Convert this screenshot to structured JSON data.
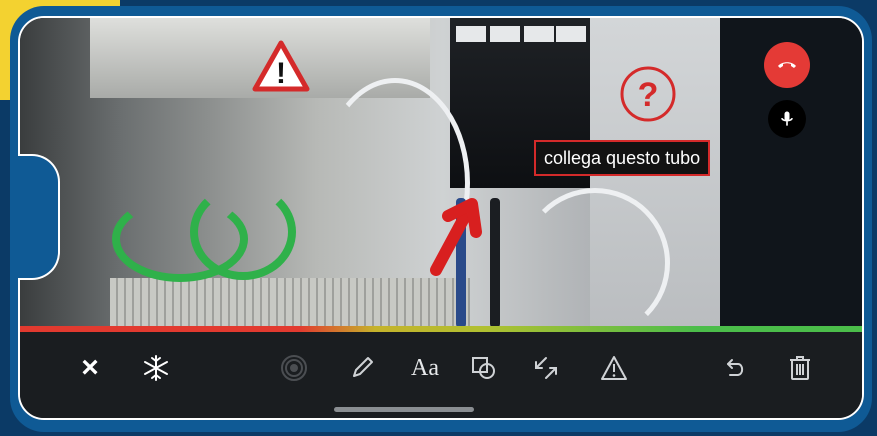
{
  "overlay": {
    "annotation_text": "collega questo tubo",
    "question_symbol": "?",
    "warning_symbol": "!"
  },
  "call": {
    "hangup_icon": "phone-hangup-icon",
    "mic_icon": "microphone-icon"
  },
  "toolbar": {
    "close_label": "×",
    "text_tool_label": "Aa",
    "tools": [
      {
        "name": "close",
        "icon": "close-icon"
      },
      {
        "name": "freeze",
        "icon": "snowflake-icon"
      },
      {
        "name": "pointer",
        "icon": "target-icon"
      },
      {
        "name": "pen",
        "icon": "pencil-icon"
      },
      {
        "name": "text",
        "icon": "text-icon"
      },
      {
        "name": "shape",
        "icon": "square-circle-icon"
      },
      {
        "name": "arrow",
        "icon": "arrows-icon"
      },
      {
        "name": "warning",
        "icon": "warning-icon"
      },
      {
        "name": "undo",
        "icon": "undo-icon"
      },
      {
        "name": "delete",
        "icon": "trash-icon"
      }
    ]
  },
  "colors": {
    "accent_red": "#e43a36",
    "progress_start": "#e23a2f",
    "progress_end": "#4bbd4a",
    "frame_blue": "#0f5a95"
  }
}
